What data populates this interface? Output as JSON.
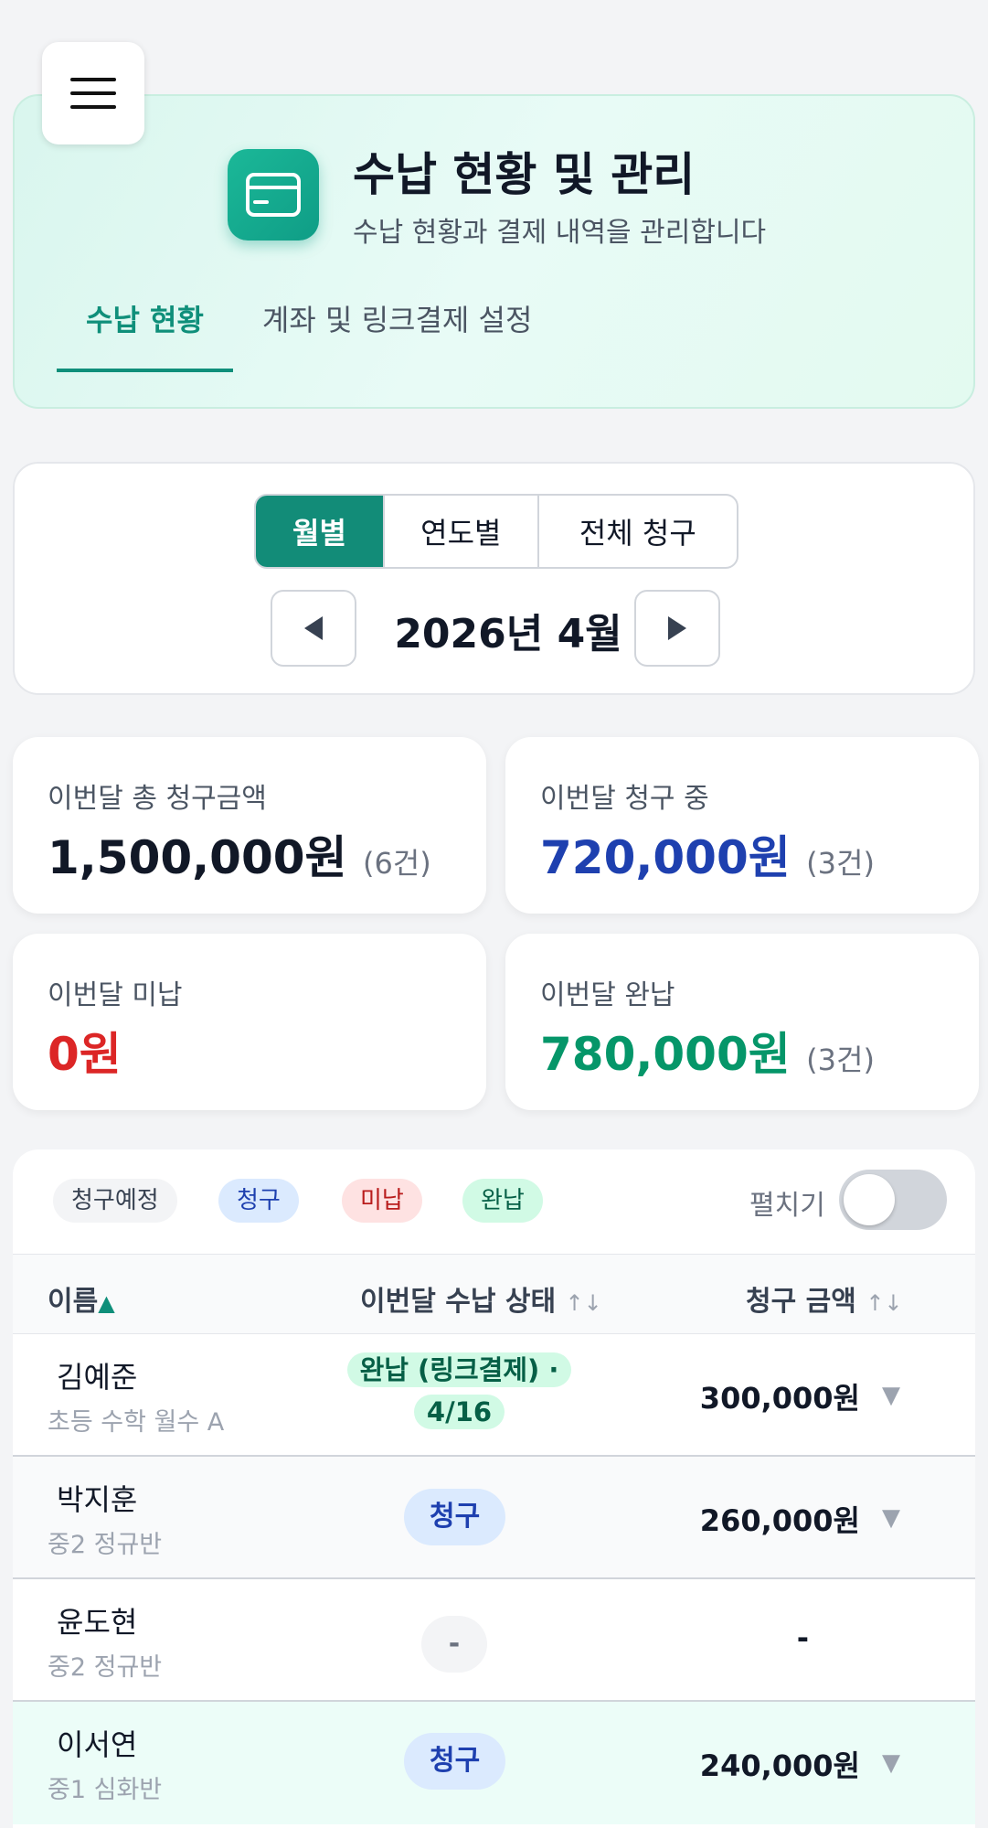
{
  "header": {
    "title": "수납 현황 및 관리",
    "subtitle": "수납 현황과 결제 내역을 관리합니다",
    "tabs": [
      {
        "label": "수납 현황",
        "active": true
      },
      {
        "label": "계좌 및 링크결제 설정",
        "active": false
      }
    ]
  },
  "period": {
    "modes": [
      "월별",
      "연도별",
      "전체 청구"
    ],
    "selected_mode": "월별",
    "current": "2026년 4월"
  },
  "stats": {
    "total": {
      "label": "이번달 총 청구금액",
      "value": "1,500,000원",
      "count": "(6건)",
      "color": "#111827"
    },
    "billing": {
      "label": "이번달 청구 중",
      "value": "720,000원",
      "count": "(3건)",
      "color": "#1e40af"
    },
    "unpaid": {
      "label": "이번달 미납",
      "value": "0원",
      "count": "",
      "color": "#dc2626"
    },
    "paid": {
      "label": "이번달 완납",
      "value": "780,000원",
      "count": "(3건)",
      "color": "#059669"
    }
  },
  "legend": {
    "scheduled": "청구예정",
    "billed": "청구",
    "unpaid": "미납",
    "paid": "완납"
  },
  "expand_toggle": {
    "label": "펼치기",
    "on": false
  },
  "table": {
    "headers": {
      "name": "이름",
      "status": "이번달 수납 상태",
      "amount": "청구 금액"
    },
    "rows": [
      {
        "name": "김예준",
        "class": "초등 수학 월수 A",
        "status": "완납 (링크결제) · 4/16",
        "status_type": "paid",
        "amount": "300,000원"
      },
      {
        "name": "박지훈",
        "class": "중2 정규반",
        "status": "청구",
        "status_type": "billed",
        "amount": "260,000원"
      },
      {
        "name": "윤도현",
        "class": "중2 정규반",
        "status": "-",
        "status_type": "none",
        "amount": "-"
      },
      {
        "name": "이서연",
        "class": "중1 심화반",
        "status": "청구",
        "status_type": "billed",
        "amount": "240,000원"
      }
    ]
  },
  "colors": {
    "accent": "#128c78",
    "billed_bg": "#dbeafe",
    "billed_text": "#1e40af",
    "paid_bg": "#d1fae5",
    "paid_text": "#065f46",
    "unpaid_bg": "#fee2e2",
    "unpaid_text": "#b91c1c"
  }
}
